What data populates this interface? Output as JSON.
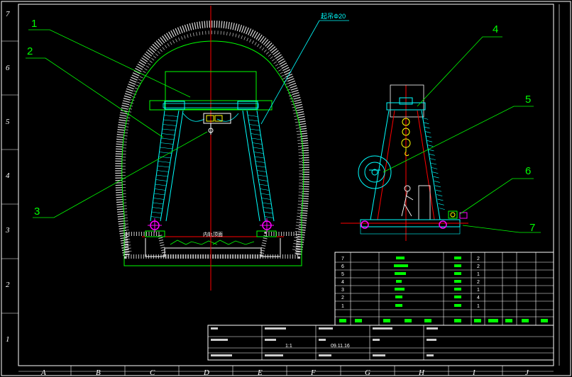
{
  "colors": {
    "background": "#000000",
    "frame": "#ffffff",
    "gantry": "#00ffff",
    "leader": "#00ff00",
    "centerline": "#ff0000",
    "tunnel": "#00ff00",
    "wheel": "#ff00ff",
    "hoist": "#ffff00"
  },
  "rulers": {
    "left": [
      "7",
      "6",
      "5",
      "4",
      "3",
      "2",
      "1"
    ],
    "bottom": [
      "A",
      "B",
      "C",
      "D",
      "E",
      "F",
      "G",
      "H",
      "I",
      "J"
    ]
  },
  "drawing": {
    "annotation_top": "起吊Φ20",
    "section_label": "内轨顶面",
    "leaders": [
      "1",
      "2",
      "3",
      "4",
      "5",
      "6",
      "7"
    ]
  },
  "parts_table": {
    "rows": [
      {
        "no": "7",
        "qty": "2"
      },
      {
        "no": "6",
        "qty": "2"
      },
      {
        "no": "5",
        "qty": "1"
      },
      {
        "no": "4",
        "qty": "2"
      },
      {
        "no": "3",
        "qty": "1"
      },
      {
        "no": "2",
        "qty": "4"
      },
      {
        "no": "1",
        "qty": "1"
      }
    ]
  },
  "title_block": {
    "scale_value": "1:1",
    "date_value": "09.11.16"
  }
}
